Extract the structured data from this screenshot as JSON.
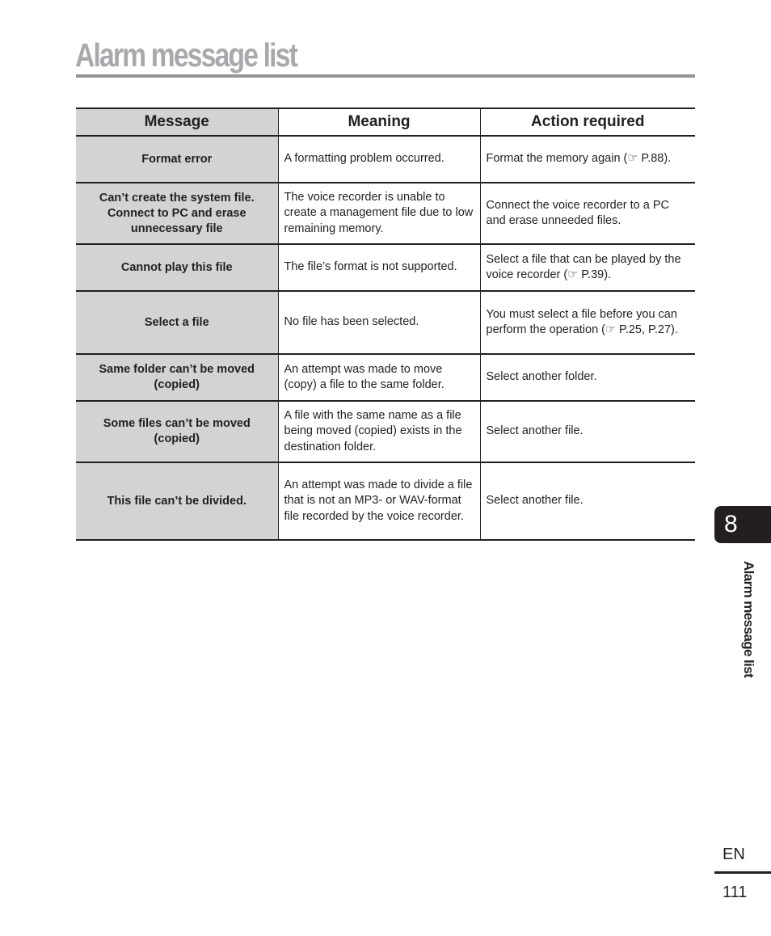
{
  "page": {
    "title": "Alarm message list",
    "chapter_number": "8",
    "side_label": "Alarm message list",
    "language": "EN",
    "page_number": "111"
  },
  "table": {
    "headers": [
      "Message",
      "Meaning",
      "Action required"
    ],
    "rows": [
      {
        "message": "Format error",
        "meaning": "A formatting problem occurred.",
        "action": "Format the memory again (☞ P.88)."
      },
      {
        "message": "Can’t create the system file. Connect to PC and erase unnecessary file",
        "meaning": "The voice recorder is unable to create a management file due to low remaining memory.",
        "action": "Connect the voice recorder to a PC and erase unneeded files."
      },
      {
        "message": "Cannot play this file",
        "meaning": "The file’s format is not supported.",
        "action": "Select a file that can be played by the voice recorder (☞ P.39)."
      },
      {
        "message": "Select a file",
        "meaning": "No file has been selected.",
        "action": "You must select a file before you can perform the operation (☞ P.25, P.27)."
      },
      {
        "message": "Same folder can’t be moved (copied)",
        "meaning": "An attempt was made to move (copy) a file to the same folder.",
        "action": "Select another folder."
      },
      {
        "message": "Some files can’t be moved (copied)",
        "meaning": "A file with the same name as a file being moved (copied) exists in the destination folder.",
        "action": "Select another file."
      },
      {
        "message": "This file can’t be divided.",
        "meaning": "An attempt was made to divide a file that is not an MP3- or WAV-format file recorded by the voice recorder.",
        "action": "Select another file."
      }
    ]
  }
}
